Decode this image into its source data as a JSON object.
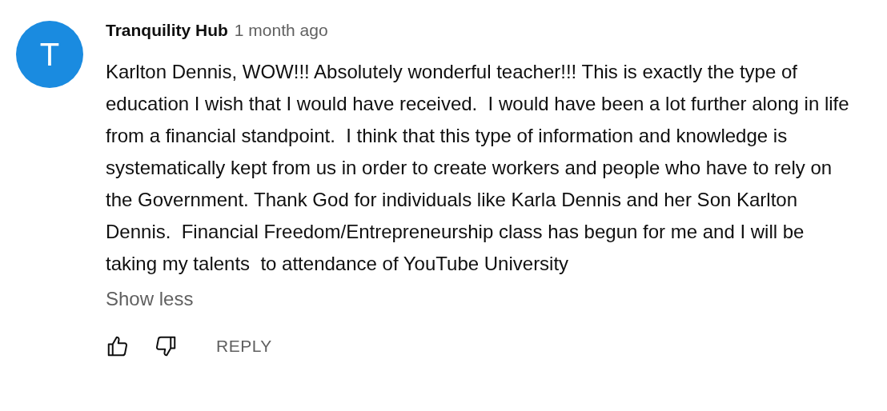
{
  "comment": {
    "avatar_letter": "T",
    "author": "Tranquility Hub",
    "time": "1 month ago",
    "text": "Karlton Dennis, WOW!!! Absolutely wonderful teacher!!! This is exactly the type of education I wish that I would have received.  I would have been a lot further along in life from a financial standpoint.  I think that this type of information and knowledge is systematically kept from us in order to create workers and people who have to rely on the Government. Thank God for individuals like Karla Dennis and her Son Karlton Dennis.  Financial Freedom/Entrepreneurship class has begun for me and I will be taking my talents  to attendance of YouTube University",
    "toggle": "Show less",
    "reply": "REPLY"
  }
}
